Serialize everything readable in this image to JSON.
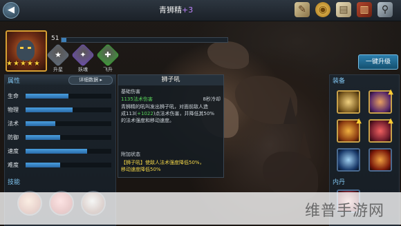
{
  "header": {
    "title": "青狮精",
    "title_plus": "+3"
  },
  "hero": {
    "level": "51",
    "level_progress": 0.03,
    "star_count": 5,
    "actions": [
      {
        "label": "升星",
        "icon": "star-badge-icon",
        "color": "#5f6a78"
      },
      {
        "label": "妖魂",
        "icon": "demon-soul-icon",
        "color": "#6b4fa8"
      },
      {
        "label": "飞升",
        "icon": "ascend-icon",
        "color": "#3f9a3a"
      }
    ]
  },
  "attributes": {
    "title": "属性",
    "detail_button": "详细数据",
    "items": [
      {
        "label": "生命",
        "value": 0.5
      },
      {
        "label": "物理",
        "value": 0.55
      },
      {
        "label": "法术",
        "value": 0.35
      },
      {
        "label": "防御",
        "value": 0.4
      },
      {
        "label": "速度",
        "value": 0.72
      },
      {
        "label": "难度",
        "value": 0.4
      }
    ]
  },
  "skills": {
    "title": "技能"
  },
  "skill_detail": {
    "name": "狮子吼",
    "section1": "基础伤害",
    "cooldown": "8秒冷却",
    "damage": "1135法术伤害",
    "desc_1": "青狮精的吼叫发出狮子吼，对面前敌人造",
    "desc_2a": "成113(",
    "desc_2b": "+1022",
    "desc_2c": ")点法术伤害，并降低其50%",
    "desc_3": "的法术强度和移动速度。",
    "section2": "附加状态",
    "status_1": "【狮子吼】使敌人法术强度降低50%，",
    "status_2": "移动速度降低50%"
  },
  "equipment": {
    "title": "装备",
    "upgrade_button": "一键升级",
    "neidan_title": "内丹"
  },
  "watermark": "维普手游网"
}
